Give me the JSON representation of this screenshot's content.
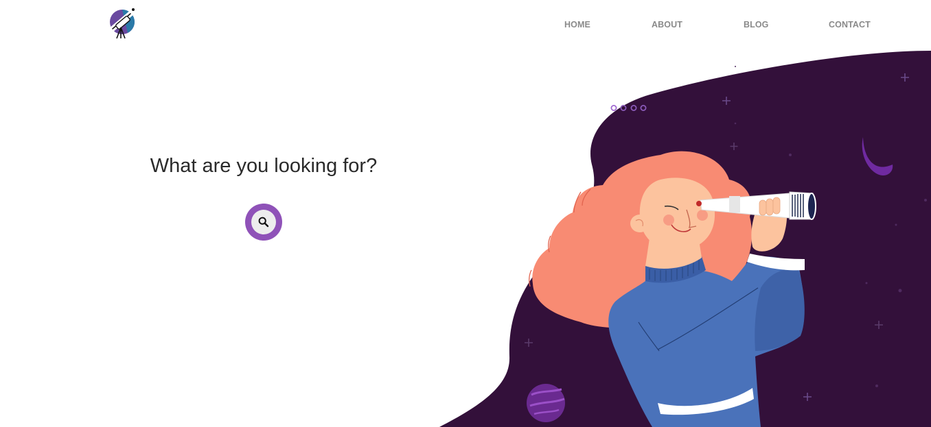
{
  "nav": {
    "items": [
      {
        "label": "HOME"
      },
      {
        "label": "ABOUT"
      },
      {
        "label": "BLOG"
      },
      {
        "label": "CONTACT"
      }
    ]
  },
  "logo": {
    "icon": "telescope-icon"
  },
  "hero": {
    "heading": "What are you looking for?",
    "search_icon": "search-icon",
    "illustration": "woman-with-telescope-illustration"
  },
  "slider": {
    "dot_count": 4,
    "active_index": 0
  },
  "colors": {
    "night_sky": "#33103a",
    "accent_purple": "#8f52b8",
    "hair": "#f88b73",
    "skin": "#fcc39e",
    "sweater": "#4a72ba",
    "nav_text": "#8a8a8a",
    "heading_text": "#2a2a2a"
  }
}
